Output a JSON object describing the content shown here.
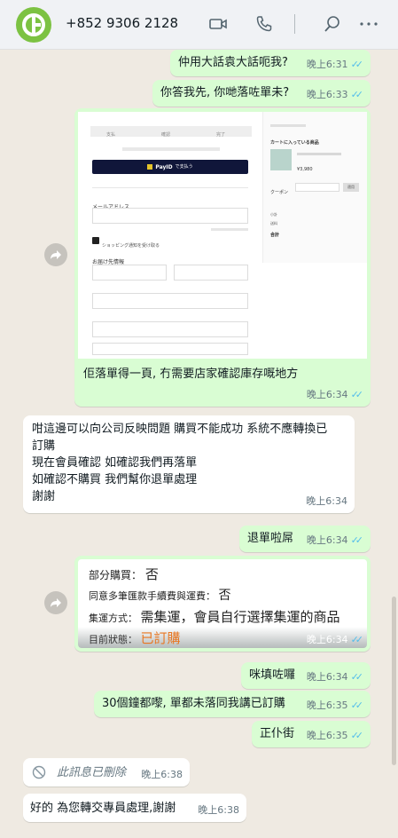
{
  "header": {
    "contact_name": "+852 9306 2128",
    "icons": [
      "avatar-logo",
      "video-call-icon",
      "phone-icon",
      "search-icon",
      "more-options-icon"
    ]
  },
  "messages": [
    {
      "text": "仲用大話袁大話呃我?",
      "time": "晚上6:31",
      "direction": "out"
    },
    {
      "text": "你答我先, 你哋落咗單未?",
      "time": "晚上6:33",
      "direction": "out"
    },
    {
      "text": "佢落單得一頁, 冇需要店家確認庫存嘅地方",
      "time": "晚上6:34",
      "direction": "out",
      "screenshot": {
        "steps": [
          "支払",
          "確認",
          "完了"
        ],
        "payid_label": "PayID",
        "payid_suffix": "で支払う",
        "email_label": "メールアドレス",
        "checkbox_label": "ショッピング通知を受け取る",
        "shipping_label": "お届け先情報",
        "cart_title": "カートに入っている商品",
        "item_price": "¥3,980",
        "coupon_label": "クーポン",
        "apply_label": "適用",
        "subtotal_label": "小計",
        "shipping_fee_label": "送料",
        "total_label": "合計"
      }
    },
    {
      "text": "咁這邊可以向公司反映問題 購買不能成功 系統不應轉換已訂購\n現在會員確認 如確認我們再落單\n如確認不購買 我們幫你退單處理\n謝謝",
      "time": "晚上6:34",
      "direction": "in"
    },
    {
      "text": "退單啦屌",
      "time": "晚上6:34",
      "direction": "out"
    },
    {
      "time": "晚上6:34",
      "direction": "out",
      "order_info": {
        "partial_label": "部分購買：",
        "partial_value": "否",
        "agree_label": "同意多筆匯款手續費與運費：",
        "agree_value": "否",
        "method_label": "集運方式：",
        "method_value": "需集運，會員自行選擇集運的商品",
        "status_label": "目前狀態：",
        "status_value": "已訂購"
      }
    },
    {
      "text": "咪填咗囉",
      "time": "晚上6:34",
      "direction": "out"
    },
    {
      "text": "30個鐘都嚟, 單都未落同我講已訂購",
      "time": "晚上6:35",
      "direction": "out"
    },
    {
      "text": "正仆街",
      "time": "晚上6:35",
      "direction": "out"
    },
    {
      "text": "此訊息已刪除",
      "time": "晚上6:38",
      "direction": "in",
      "deleted": true
    },
    {
      "text": "好的 為您轉交專員處理,謝謝",
      "time": "晚上6:38",
      "direction": "in"
    }
  ],
  "colors": {
    "outgoing_bubble": "#d9fdd3",
    "incoming_bubble": "#ffffff",
    "chat_background": "#efeae2",
    "read_ticks": "#53bdeb",
    "status_orange": "#e87722"
  }
}
